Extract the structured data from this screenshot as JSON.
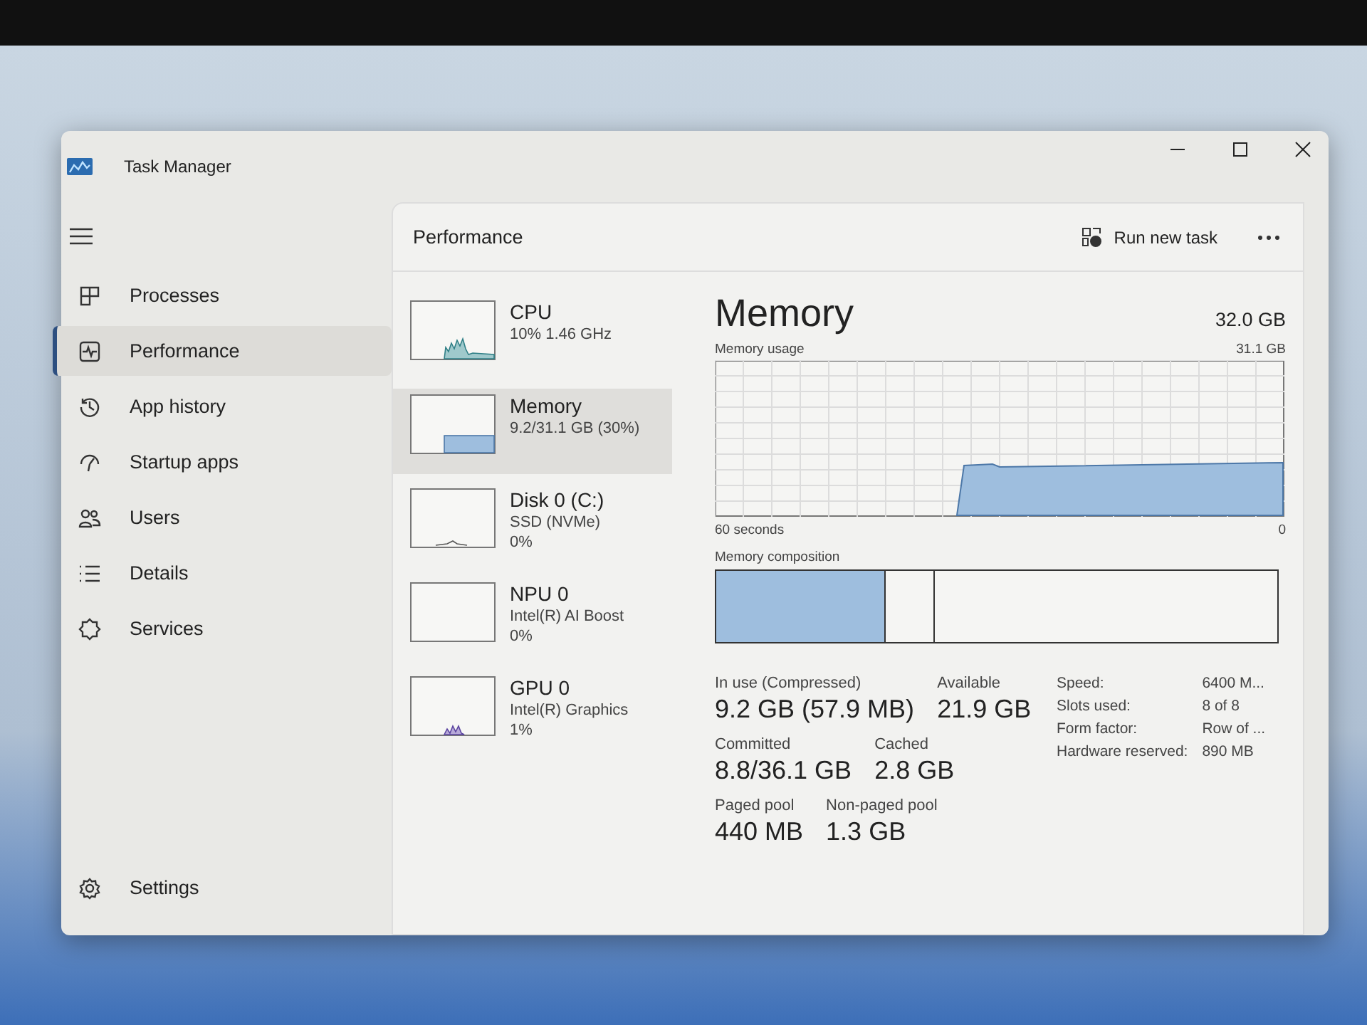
{
  "window": {
    "title": "Task Manager"
  },
  "sidebar": {
    "items": [
      {
        "label": "Processes",
        "kind": "processes",
        "selected": false
      },
      {
        "label": "Performance",
        "kind": "performance",
        "selected": true
      },
      {
        "label": "App history",
        "kind": "history",
        "selected": false
      },
      {
        "label": "Startup apps",
        "kind": "startup",
        "selected": false
      },
      {
        "label": "Users",
        "kind": "users",
        "selected": false
      },
      {
        "label": "Details",
        "kind": "details",
        "selected": false
      },
      {
        "label": "Services",
        "kind": "services",
        "selected": false
      }
    ],
    "settings": "Settings"
  },
  "header": {
    "title": "Performance",
    "run_new_task": "Run new task"
  },
  "devices": [
    {
      "kind": "cpu",
      "name": "CPU",
      "lines": [
        "10%  1.46 GHz"
      ],
      "selected": false
    },
    {
      "kind": "memory",
      "name": "Memory",
      "lines": [
        "9.2/31.1 GB (30%)"
      ],
      "selected": true
    },
    {
      "kind": "disk",
      "name": "Disk 0 (C:)",
      "lines": [
        "SSD (NVMe)",
        "0%"
      ],
      "selected": false
    },
    {
      "kind": "npu",
      "name": "NPU 0",
      "lines": [
        "Intel(R) AI Boost",
        "0%"
      ],
      "selected": false
    },
    {
      "kind": "gpu",
      "name": "GPU 0",
      "lines": [
        "Intel(R) Graphics",
        "1%"
      ],
      "selected": false
    }
  ],
  "detail": {
    "title": "Memory",
    "total": "32.0 GB",
    "usage_label": "Memory usage",
    "usage_max": "31.1 GB",
    "time_label": "60 seconds",
    "time_end": "0",
    "composition_label": "Memory composition",
    "stats": [
      {
        "label": "In use (Compressed)",
        "value": "9.2 GB (57.9 MB)"
      },
      {
        "label": "Available",
        "value": "21.9 GB"
      },
      {
        "label": "Committed",
        "value": "8.8/36.1 GB"
      },
      {
        "label": "Cached",
        "value": "2.8 GB"
      },
      {
        "label": "Paged pool",
        "value": "440 MB"
      },
      {
        "label": "Non-paged pool",
        "value": "1.3 GB"
      }
    ],
    "specs": [
      {
        "label": "Speed:",
        "value": "6400 M..."
      },
      {
        "label": "Slots used:",
        "value": "8 of 8"
      },
      {
        "label": "Form factor:",
        "value": "Row of ..."
      },
      {
        "label": "Hardware reserved:",
        "value": "890 MB"
      }
    ]
  }
}
